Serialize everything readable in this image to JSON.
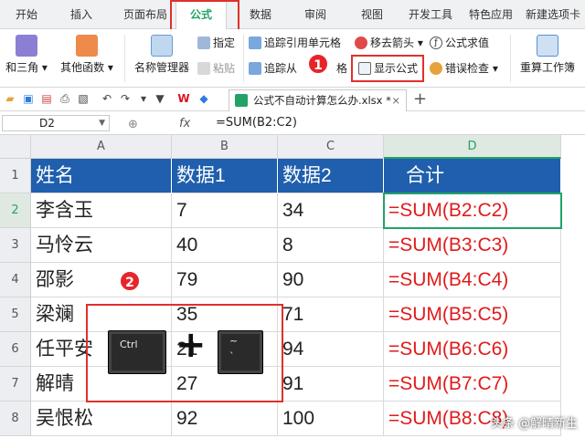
{
  "tabs": [
    "开始",
    "插入",
    "页面布局",
    "公式",
    "数据",
    "审阅",
    "视图",
    "开发工具",
    "特色应用",
    "新建选项卡"
  ],
  "active_tab": "公式",
  "ribbon": {
    "trig_label": "和三角 ▾",
    "other_func_label": "其他函数 ▾",
    "name_manager_label": "名称管理器",
    "specify_label": "指定",
    "paste_label": "粘贴",
    "trace_precedents_label": "追踪引用单元格",
    "trace_dependents_label": "追踪从",
    "trace_dependents_suffix": "格",
    "remove_arrows_label": "移去箭头 ▾",
    "show_formula_label": "显示公式",
    "formula_eval_label": "公式求值",
    "error_check_label": "错误检查 ▾",
    "recalc_label": "重算工作簿",
    "accent": "#21a366"
  },
  "doc_tab": {
    "title": "公式不自动计算怎么办.xlsx *",
    "close": "×",
    "add": "+"
  },
  "name_box": "D2",
  "fx": "fx",
  "formula": "=SUM(B2:C2)",
  "columns": [
    "A",
    "B",
    "C",
    "D"
  ],
  "rows": [
    "1",
    "2",
    "3",
    "4",
    "5",
    "6",
    "7",
    "8"
  ],
  "header_row": [
    "姓名",
    "数据1",
    "数据2",
    "合计"
  ],
  "data": [
    [
      "李含玉",
      "7",
      "34",
      "=SUM(B2:C2)"
    ],
    [
      "马怜云",
      "40",
      "8",
      "=SUM(B3:C3)"
    ],
    [
      "邵影",
      "79",
      "90",
      "=SUM(B4:C4)"
    ],
    [
      "梁斓",
      "35",
      "71",
      "=SUM(B5:C5)"
    ],
    [
      "任平安",
      "21",
      "94",
      "=SUM(B6:C6)"
    ],
    [
      "解晴",
      "27",
      "91",
      "=SUM(B7:C7)"
    ],
    [
      "吴恨松",
      "92",
      "100",
      "=SUM(B8:C8)"
    ]
  ],
  "overlay": {
    "badge1": "1",
    "badge2": "2",
    "key_ctrl": "Ctrl",
    "plus": "+",
    "key_tilde": "~",
    "key_grave": "`",
    "watermark": "头条 @解晴新生"
  }
}
